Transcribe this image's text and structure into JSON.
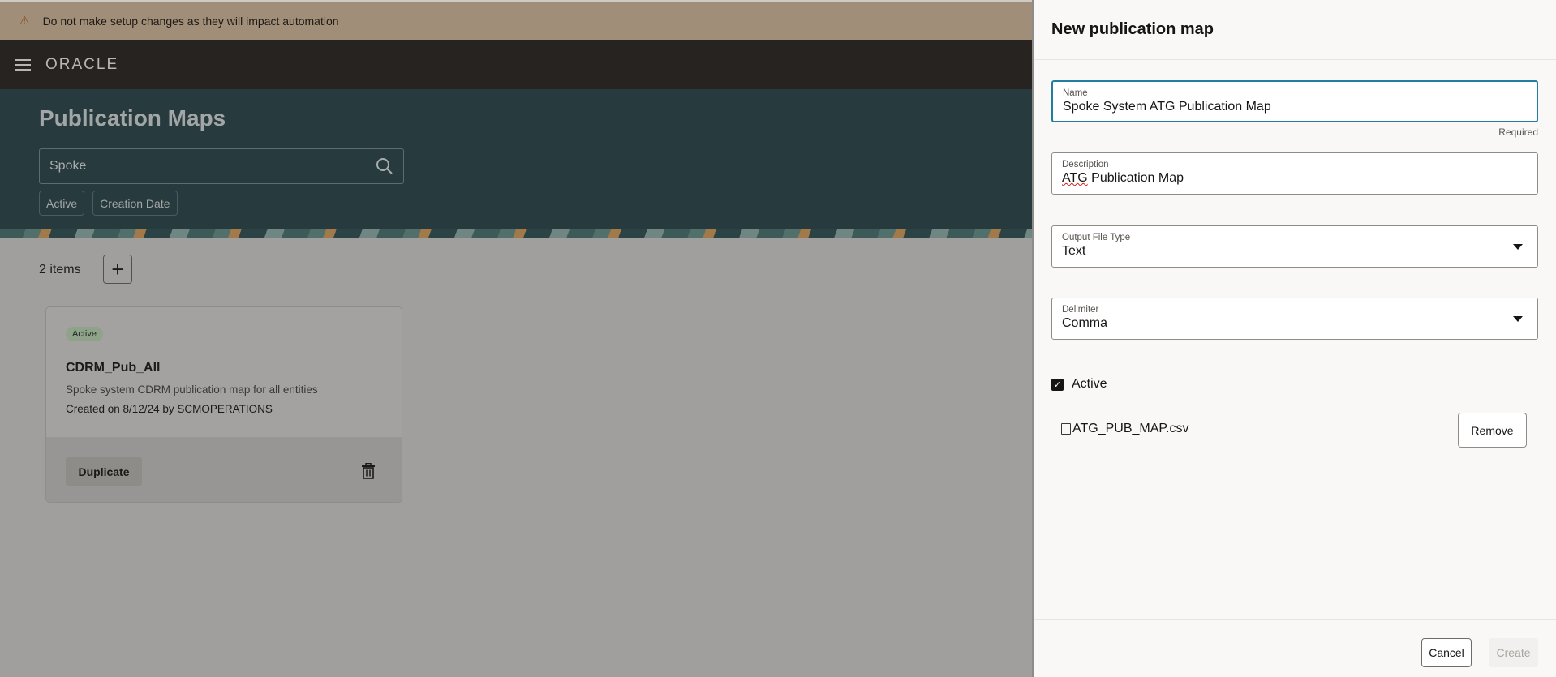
{
  "banner": {
    "icon": "warning-icon",
    "text": "Do not make setup changes as they will impact automation"
  },
  "topbar": {
    "menu_icon": "hamburger-menu-icon",
    "logo": "ORACLE"
  },
  "hero": {
    "title": "Publication Maps",
    "search": {
      "value": "Spoke",
      "icon": "search-icon"
    },
    "filters": [
      "Active",
      "Creation Date"
    ]
  },
  "list": {
    "count_label": "2 items",
    "add_icon": "plus-icon",
    "cards": [
      {
        "status": "Active",
        "title": "CDRM_Pub_All",
        "description": "Spoke system CDRM publication map for all entities",
        "meta": "Created on 8/12/24 by SCMOPERATIONS",
        "duplicate_label": "Duplicate",
        "delete_icon": "trash-icon"
      }
    ]
  },
  "drawer": {
    "title": "New publication map",
    "name": {
      "label": "Name",
      "value": "Spoke System ATG Publication Map",
      "hint": "Required"
    },
    "description": {
      "label": "Description",
      "value_flagged": "ATG",
      "value_rest": " Publication Map"
    },
    "output_file_type": {
      "label": "Output File Type",
      "value": "Text"
    },
    "delimiter": {
      "label": "Delimiter",
      "value": "Comma"
    },
    "active": {
      "label": "Active",
      "checked": true
    },
    "file": {
      "name": "ATG_PUB_MAP.csv",
      "remove_label": "Remove"
    },
    "footer": {
      "cancel_label": "Cancel",
      "create_label": "Create"
    }
  },
  "colors": {
    "accent": "#227e9e",
    "header_bg": "#273a3e",
    "banner_bg": "#a08e78",
    "topbar_bg": "#262321"
  }
}
